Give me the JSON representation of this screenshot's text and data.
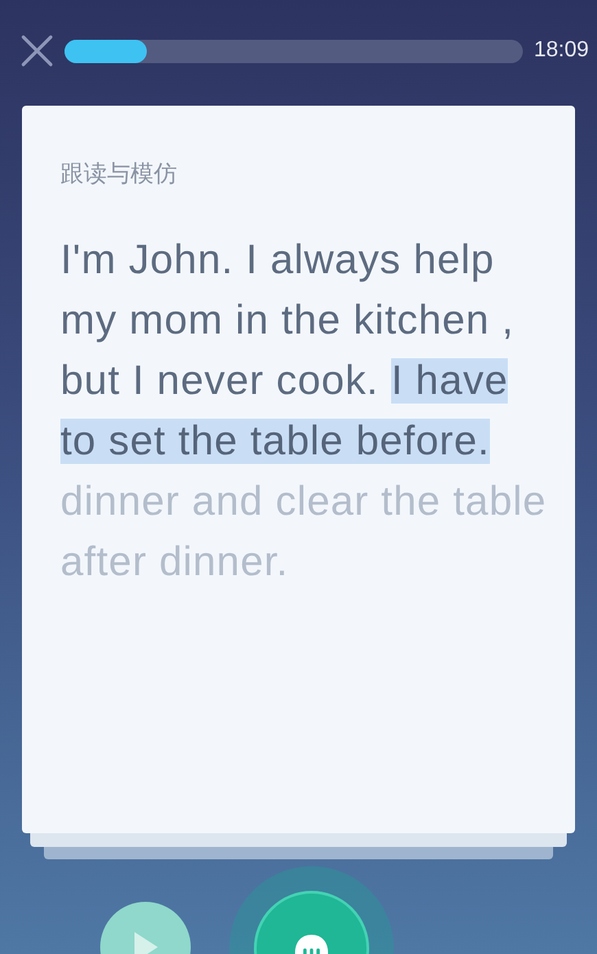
{
  "progress": {
    "level": 0.18
  },
  "time": "18:09",
  "card": {
    "title": "跟读与模仿",
    "segments": [
      {
        "text": "I'm John. I always help my mom in the kitchen , but I never cook. ",
        "highlighted": false,
        "dimmed": false
      },
      {
        "text": "I have to set the table before.",
        "highlighted": true,
        "dimmed": false
      },
      {
        "text": " dinner and clear the table after dinner.",
        "highlighted": false,
        "dimmed": true
      }
    ]
  }
}
